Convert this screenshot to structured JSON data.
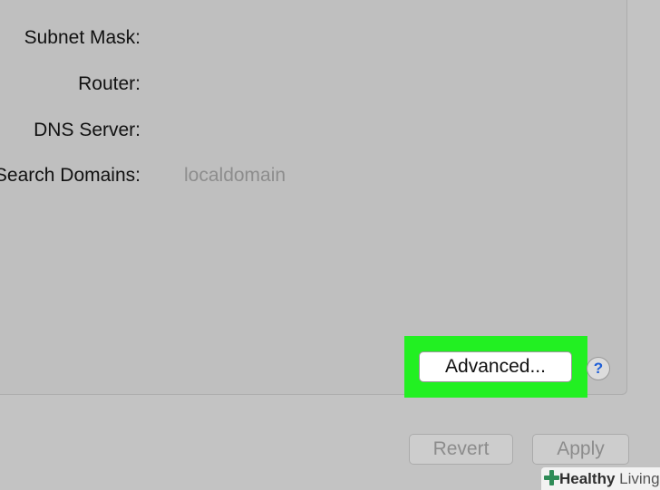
{
  "fields": [
    {
      "label": "Subnet Mask:",
      "value": ""
    },
    {
      "label": "Router:",
      "value": ""
    },
    {
      "label": "DNS Server:",
      "value": ""
    },
    {
      "label": "Search Domains:",
      "value": "localdomain"
    }
  ],
  "buttons": {
    "advanced_label": "Advanced...",
    "help_label": "?",
    "revert_label": "Revert",
    "apply_label": "Apply"
  },
  "watermark": {
    "brand_bold": "Healthy",
    "brand_light": " Living"
  },
  "colors": {
    "highlight": "#22f022",
    "help_glyph": "#1e5fd8",
    "watermark_plus": "#2e8b57"
  },
  "icons": {
    "help": "question-mark-icon",
    "watermark": "plus-icon"
  }
}
